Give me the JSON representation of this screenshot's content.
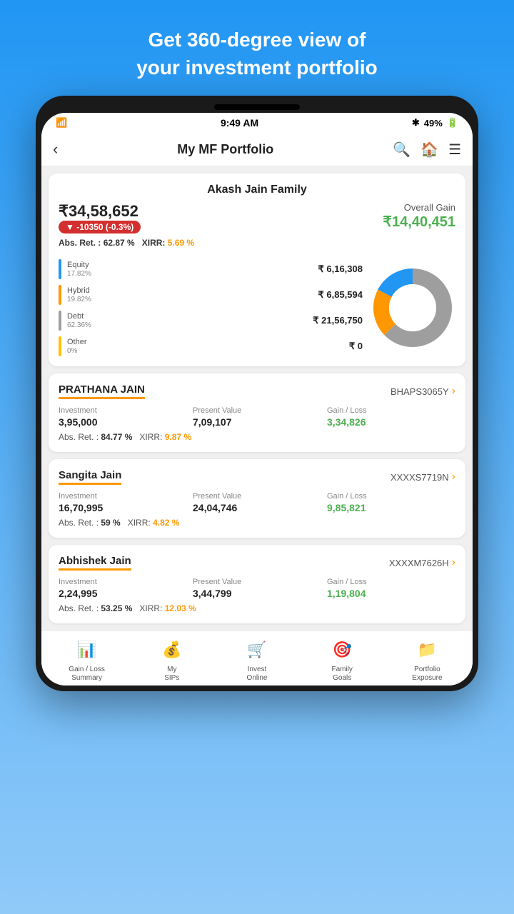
{
  "page": {
    "header_line1": "Get 360-degree view of",
    "header_line2": "your investment portfolio"
  },
  "status_bar": {
    "time": "9:49 AM",
    "battery": "49%"
  },
  "nav": {
    "back_label": "‹",
    "title": "My MF Portfolio"
  },
  "portfolio": {
    "family_name": "Akash Jain Family",
    "total_amount": "₹34,58,652",
    "loss_badge": "▼ -10350  (-0.3%)",
    "overall_gain_label": "Overall Gain",
    "overall_gain_value": "₹14,40,451",
    "abs_ret_label": "Abs. Ret. :",
    "abs_ret_value": "62.87 %",
    "xirr_label": "XIRR:",
    "xirr_value": "5.69 %",
    "breakdown": [
      {
        "label": "Equity",
        "percent": "17.82%",
        "value": "₹ 6,16,308",
        "color": "#2196F3"
      },
      {
        "label": "Hybrid",
        "percent": "19.82%",
        "value": "₹ 6,85,594",
        "color": "#FF9800"
      },
      {
        "label": "Debt",
        "percent": "62.36%",
        "value": "₹ 21,56,750",
        "color": "#9E9E9E"
      },
      {
        "label": "Other",
        "percent": "0%",
        "value": "₹ 0",
        "color": "#FFC107"
      }
    ],
    "donut": {
      "segments": [
        {
          "color": "#2196F3",
          "percent": 17.82
        },
        {
          "color": "#FF9800",
          "percent": 19.82
        },
        {
          "color": "#9E9E9E",
          "percent": 62.36
        }
      ]
    }
  },
  "persons": [
    {
      "name": "PRATHANA JAIN",
      "id": "BHAPS3065Y",
      "investment_label": "Investment",
      "investment_value": "3,95,000",
      "present_label": "Present Value",
      "present_value": "7,09,107",
      "gain_label": "Gain / Loss",
      "gain_value": "3,34,826",
      "abs_ret": "84.77 %",
      "xirr": "9.87 %"
    },
    {
      "name": "Sangita Jain",
      "id": "XXXXS7719N",
      "investment_label": "Investment",
      "investment_value": "16,70,995",
      "present_label": "Present Value",
      "present_value": "24,04,746",
      "gain_label": "Gain / Loss",
      "gain_value": "9,85,821",
      "abs_ret": "59 %",
      "xirr": "4.82 %"
    },
    {
      "name": "Abhishek Jain",
      "id": "XXXXM7626H",
      "investment_label": "Investment",
      "investment_value": "2,24,995",
      "present_label": "Present Value",
      "present_value": "3,44,799",
      "gain_label": "Gain / Loss",
      "gain_value": "1,19,804",
      "abs_ret": "53.25 %",
      "xirr": "12.03 %"
    }
  ],
  "bottom_nav": [
    {
      "icon": "📊",
      "label": "Gain / Loss\nSummary"
    },
    {
      "icon": "💰",
      "label": "My\nSIPs"
    },
    {
      "icon": "🛒",
      "label": "Invest\nOnline"
    },
    {
      "icon": "🎯",
      "label": "Family\nGoals"
    },
    {
      "icon": "📁",
      "label": "Portfolio\nExposure"
    }
  ]
}
